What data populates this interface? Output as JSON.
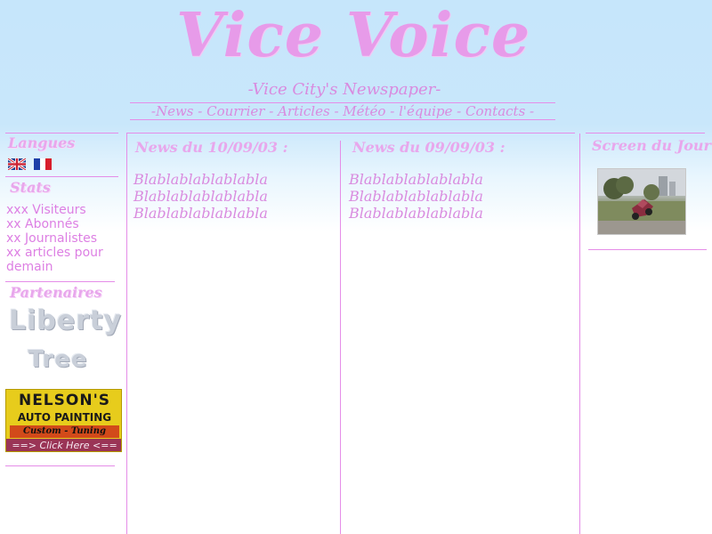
{
  "header": {
    "title": "Vice Voice",
    "subtitle": "-Vice City's Newspaper-",
    "nav": {
      "prefix": "-",
      "items": [
        "News",
        "Courrier",
        "Articles",
        "Météo",
        "l'équipe",
        "Contacts"
      ],
      "separator": " - ",
      "suffix": " -"
    }
  },
  "sidebar": {
    "langues_heading": "Langues",
    "stats_heading": "Stats",
    "stats": {
      "visiteurs": "xxx Visiteurs",
      "abonnes": "xx Abonnés",
      "journalistes": "xx Journalistes",
      "articles": "xx articles pour demain"
    },
    "partenaires_heading": "Partenaires",
    "partner1": {
      "line1": "Liberty",
      "line2": "Tree"
    },
    "ad": {
      "line1": "NELSON'S",
      "line2": "AUTO PAINTING",
      "line3": "Custom - Tuning",
      "line4": "==> Click Here <=="
    }
  },
  "news": [
    {
      "heading": "News du 10/09/03 :",
      "lines": [
        "Blablablablablabla",
        "Blablablablablabla",
        "Blablablablablabla"
      ]
    },
    {
      "heading": "News du 09/09/03 :",
      "lines": [
        "Blablablablablabla",
        "Blablablablablabla",
        "Blablablablablabla"
      ]
    }
  ],
  "right": {
    "heading": "Screen du Jour"
  },
  "colors": {
    "accent_pink": "#e08ae8",
    "sky_blue": "#c6e6fb"
  },
  "icons": {
    "flag_en": "uk-flag-icon",
    "flag_fr": "france-flag-icon"
  }
}
